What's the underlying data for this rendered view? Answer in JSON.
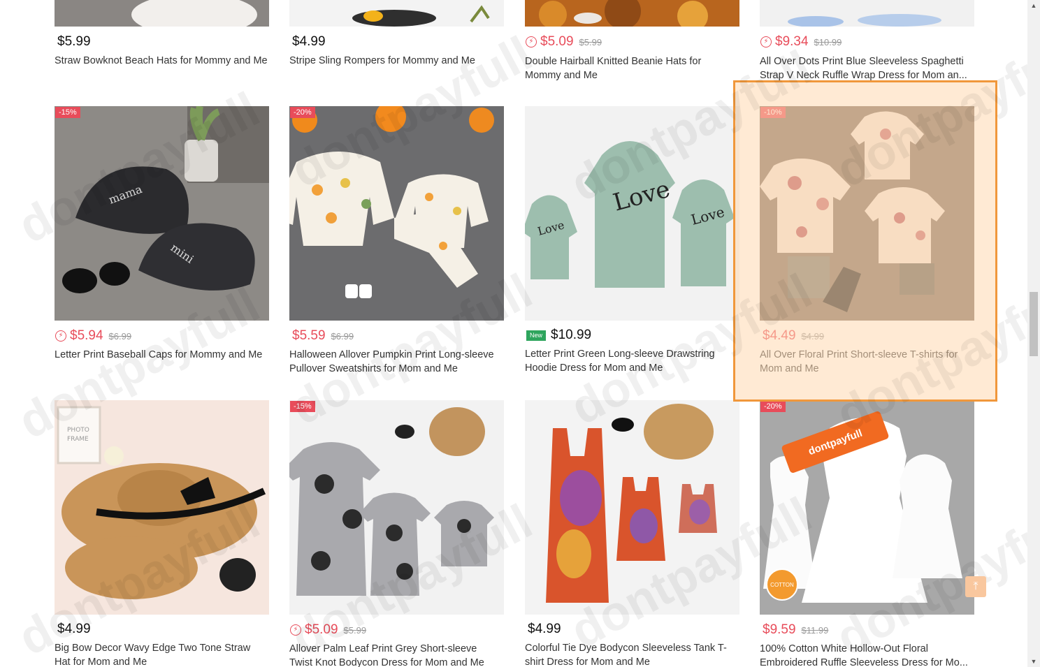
{
  "products": [
    {
      "price": "$5.99",
      "old_price": "",
      "flash": false,
      "new": false,
      "badge": "",
      "title": "Straw Bowknot Beach Hats for Mommy and Me"
    },
    {
      "price": "$4.99",
      "old_price": "",
      "flash": false,
      "new": false,
      "badge": "",
      "title": "Stripe Sling Rompers for Mommy and Me"
    },
    {
      "price": "$5.09",
      "old_price": "$5.99",
      "flash": true,
      "new": false,
      "badge": "",
      "title": "Double Hairball Knitted Beanie Hats for Mommy and Me"
    },
    {
      "price": "$9.34",
      "old_price": "$10.99",
      "flash": true,
      "new": false,
      "badge": "",
      "title": "All Over Dots Print Blue Sleeveless Spaghetti Strap V Neck Ruffle Wrap Dress for Mom an..."
    },
    {
      "price": "$5.94",
      "old_price": "$6.99",
      "flash": true,
      "new": false,
      "badge": "-15%",
      "title": "Letter Print Baseball Caps for Mommy and Me"
    },
    {
      "price": "$5.59",
      "old_price": "$6.99",
      "flash": false,
      "new": false,
      "badge": "-20%",
      "title": "Halloween Allover Pumpkin Print Long-sleeve Pullover Sweatshirts for Mom and Me"
    },
    {
      "price": "$10.99",
      "old_price": "",
      "flash": false,
      "new": true,
      "new_label": "New",
      "badge": "",
      "title": "Letter Print Green Long-sleeve Drawstring Hoodie Dress for Mom and Me"
    },
    {
      "price": "$4.49",
      "old_price": "$4.99",
      "flash": false,
      "new": false,
      "badge": "-10%",
      "title": "All Over Floral Print Short-sleeve T-shirts for Mom and Me"
    },
    {
      "price": "$4.99",
      "old_price": "",
      "flash": false,
      "new": false,
      "badge": "",
      "title": "Big Bow Decor Wavy Edge Two Tone Straw Hat for Mom and Me"
    },
    {
      "price": "$5.09",
      "old_price": "$5.99",
      "flash": true,
      "new": false,
      "badge": "-15%",
      "title": "Allover Palm Leaf Print Grey Short-sleeve Twist Knot Bodycon Dress for Mom and Me"
    },
    {
      "price": "$4.99",
      "old_price": "",
      "flash": false,
      "new": false,
      "badge": "",
      "title": "Colorful Tie Dye Bodycon Sleeveless Tank T-shirt Dress for Mom and Me"
    },
    {
      "price": "$9.59",
      "old_price": "$11.99",
      "flash": false,
      "new": false,
      "badge": "-20%",
      "title": "100% Cotton White Hollow-Out Floral Embroidered Ruffle Sleeveless Dress for Mo..."
    }
  ],
  "overlay": {
    "watermark": "dontpayfull",
    "banner": "dontpayfull",
    "cotton_badge": "COTTON",
    "back_to_top_icon": "arrow-up-to-line-icon"
  },
  "colors": {
    "sale_red": "#e84c5a",
    "new_green": "#2ea55d",
    "highlight_border": "#f0973b",
    "highlight_fill": "#ffd9b0"
  }
}
